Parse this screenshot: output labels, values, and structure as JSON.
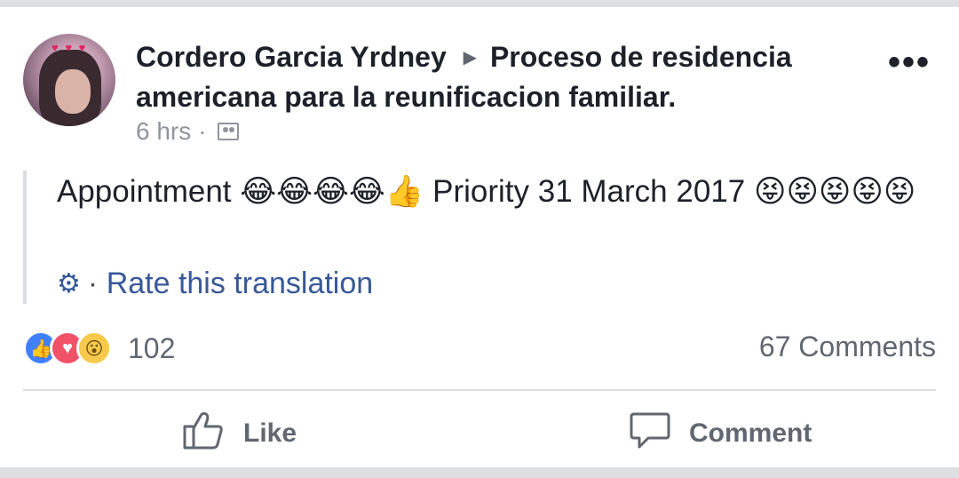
{
  "post": {
    "author": "Cordero Garcia Yrdney",
    "group": "Proceso de residencia americana para la reunificacion familiar.",
    "time": "6 hrs",
    "body_text": "Appointment 😂😂😂😂👍 Priority 31 March 2017 😝😝😝😝😝",
    "translate_label": "Rate this translation"
  },
  "reactions": {
    "count": "102",
    "types": [
      "like",
      "love",
      "wow"
    ]
  },
  "comments_count": "67 Comments",
  "actions": {
    "like_label": "Like",
    "comment_label": "Comment"
  },
  "icons": {
    "audience": "people-icon",
    "translate": "gear-icon",
    "like": "thumbs-up-icon",
    "comment": "speech-bubble-icon",
    "more": "more-dots-icon"
  },
  "colors": {
    "link_blue": "#385898",
    "like_blue": "#4080ff",
    "love_red": "#f25268",
    "wow_yellow": "#f7c94c"
  }
}
